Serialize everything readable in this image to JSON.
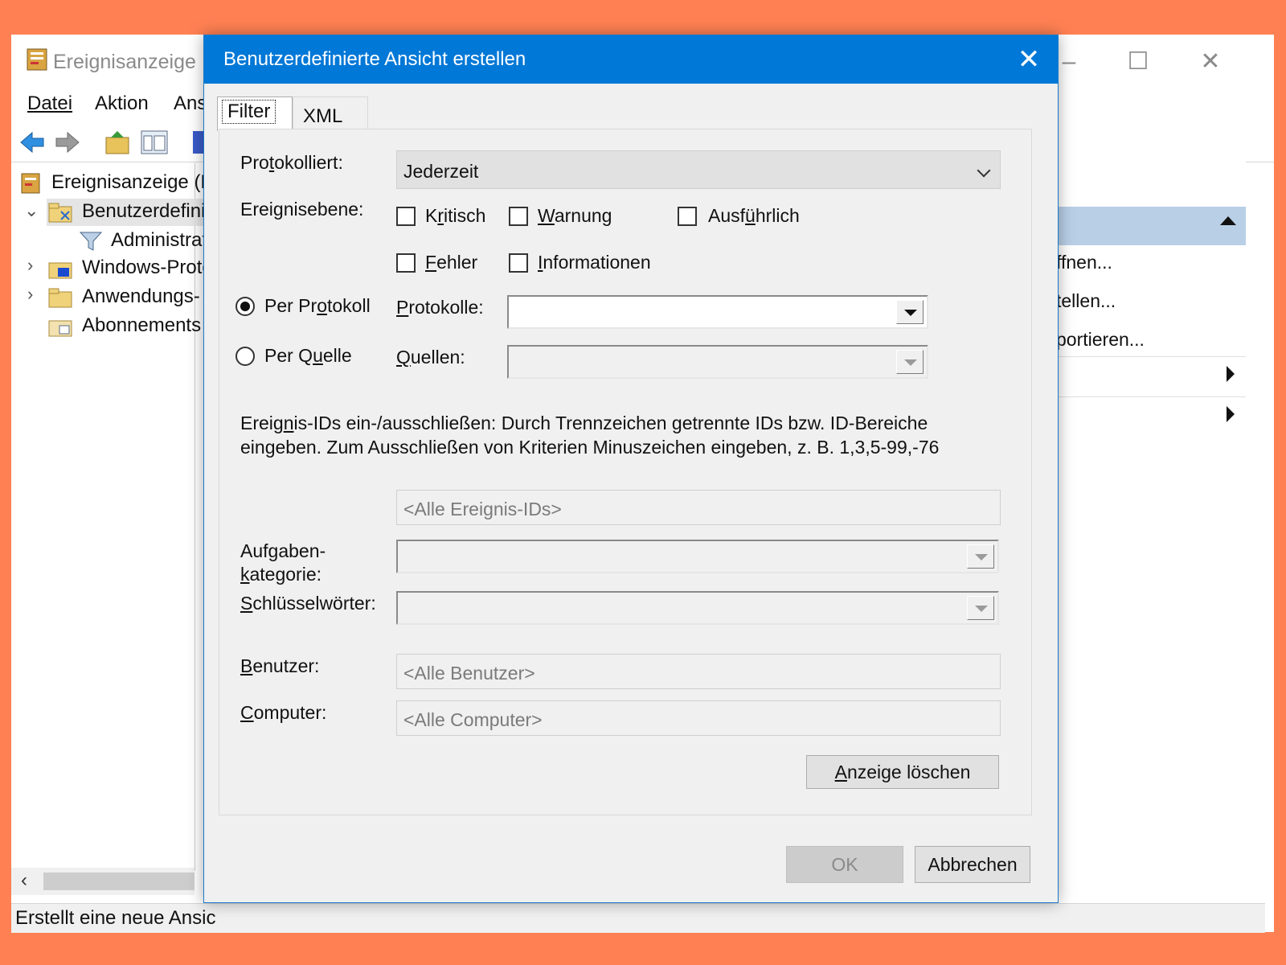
{
  "colors": {
    "accent": "#0078d7",
    "backdrop": "#ff8153"
  },
  "main_window": {
    "title": "Ereignisanzeige",
    "menu": [
      "Datei",
      "Aktion",
      "Ans"
    ],
    "tree": [
      {
        "label": "Ereignisanzeige (Lo",
        "icon": "event-viewer-icon"
      },
      {
        "label": "Benutzerdefini",
        "icon": "custom-views-folder-icon",
        "expanded": true,
        "selected": true
      },
      {
        "label": "Administrat",
        "icon": "filter-icon"
      },
      {
        "label": "Windows-Proto",
        "icon": "windows-logs-folder-icon",
        "collapsed": true
      },
      {
        "label": "Anwendungs-",
        "icon": "app-logs-folder-icon",
        "collapsed": true
      },
      {
        "label": "Abonnements",
        "icon": "subscriptions-icon"
      }
    ],
    "status": "Erstellt eine neue Ansic",
    "actions": [
      "ffnen...",
      "tellen...",
      "portieren..."
    ]
  },
  "dialog": {
    "title": "Benutzerdefinierte Ansicht erstellen",
    "tabs": [
      "Filter",
      "XML"
    ],
    "active_tab": "Filter",
    "protokolliert": {
      "label": "Protokolliert:",
      "value": "Jederzeit"
    },
    "ereignisebene": {
      "label": "Ereignisebene:",
      "options": [
        {
          "label": "Kritisch",
          "checked": false
        },
        {
          "label": "Warnung",
          "checked": false
        },
        {
          "label": "Ausführlich",
          "checked": false
        },
        {
          "label": "Fehler",
          "checked": false
        },
        {
          "label": "Informationen",
          "checked": false
        }
      ]
    },
    "per_protokoll": {
      "label": "Per Protokoll",
      "selected": true
    },
    "per_quelle": {
      "label": "Per Quelle",
      "selected": false
    },
    "protokolle": {
      "label": "Protokolle:",
      "value": ""
    },
    "quellen": {
      "label": "Quellen:",
      "value": ""
    },
    "ids_description": [
      "Ereignis-IDs ein-/ausschließen: Durch Trennzeichen getrennte IDs bzw. ID-Bereiche",
      "eingeben. Zum Ausschließen von Kriterien Minuszeichen eingeben, z. B. 1,3,5-99,-76"
    ],
    "ids_placeholder": "<Alle Ereignis-IDs>",
    "aufgabenkategorie": {
      "label_line1": "Aufgaben-",
      "label_line2": "kategorie:",
      "value": ""
    },
    "schluesselwoerter": {
      "label": "Schlüsselwörter:",
      "value": ""
    },
    "benutzer": {
      "label": "Benutzer:",
      "placeholder": "<Alle Benutzer>"
    },
    "computer": {
      "label": "Computer:",
      "placeholder": "<Alle Computer>"
    },
    "clear_button": "Anzeige löschen",
    "ok_button": "OK",
    "cancel_button": "Abbrechen"
  }
}
